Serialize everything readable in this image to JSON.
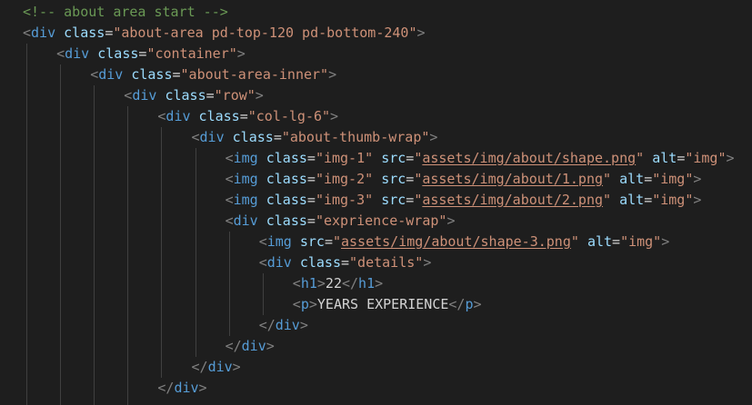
{
  "editor": {
    "language": "html",
    "colors": {
      "background": "#1e1e1e",
      "comment": "#6a9955",
      "tag": "#569cd6",
      "attribute": "#9cdcfe",
      "string": "#ce9178",
      "bracket": "#808080",
      "text": "#d4d4d4",
      "indent_guide": "#404040"
    },
    "lines": [
      {
        "indent": 0,
        "tokens": [
          {
            "t": "comment",
            "v": "<!-- about area start -->"
          }
        ]
      },
      {
        "indent": 0,
        "tokens": [
          {
            "t": "bracket",
            "v": "<"
          },
          {
            "t": "tag",
            "v": "div"
          },
          {
            "t": "text",
            "v": " "
          },
          {
            "t": "attr",
            "v": "class"
          },
          {
            "t": "eq",
            "v": "="
          },
          {
            "t": "str",
            "v": "\"about-area pd-top-120 pd-bottom-240\""
          },
          {
            "t": "bracket",
            "v": ">"
          }
        ]
      },
      {
        "indent": 1,
        "tokens": [
          {
            "t": "bracket",
            "v": "<"
          },
          {
            "t": "tag",
            "v": "div"
          },
          {
            "t": "text",
            "v": " "
          },
          {
            "t": "attr",
            "v": "class"
          },
          {
            "t": "eq",
            "v": "="
          },
          {
            "t": "str",
            "v": "\"container\""
          },
          {
            "t": "bracket",
            "v": ">"
          }
        ]
      },
      {
        "indent": 2,
        "tokens": [
          {
            "t": "bracket",
            "v": "<"
          },
          {
            "t": "tag",
            "v": "div"
          },
          {
            "t": "text",
            "v": " "
          },
          {
            "t": "attr",
            "v": "class"
          },
          {
            "t": "eq",
            "v": "="
          },
          {
            "t": "str",
            "v": "\"about-area-inner\""
          },
          {
            "t": "bracket",
            "v": ">"
          }
        ]
      },
      {
        "indent": 3,
        "tokens": [
          {
            "t": "bracket",
            "v": "<"
          },
          {
            "t": "tag",
            "v": "div"
          },
          {
            "t": "text",
            "v": " "
          },
          {
            "t": "attr",
            "v": "class"
          },
          {
            "t": "eq",
            "v": "="
          },
          {
            "t": "str",
            "v": "\"row\""
          },
          {
            "t": "bracket",
            "v": ">"
          }
        ]
      },
      {
        "indent": 4,
        "tokens": [
          {
            "t": "bracket",
            "v": "<"
          },
          {
            "t": "tag",
            "v": "div"
          },
          {
            "t": "text",
            "v": " "
          },
          {
            "t": "attr",
            "v": "class"
          },
          {
            "t": "eq",
            "v": "="
          },
          {
            "t": "str",
            "v": "\"col-lg-6\""
          },
          {
            "t": "bracket",
            "v": ">"
          }
        ]
      },
      {
        "indent": 5,
        "tokens": [
          {
            "t": "bracket",
            "v": "<"
          },
          {
            "t": "tag",
            "v": "div"
          },
          {
            "t": "text",
            "v": " "
          },
          {
            "t": "attr",
            "v": "class"
          },
          {
            "t": "eq",
            "v": "="
          },
          {
            "t": "str",
            "v": "\"about-thumb-wrap\""
          },
          {
            "t": "bracket",
            "v": ">"
          }
        ]
      },
      {
        "indent": 6,
        "tokens": [
          {
            "t": "bracket",
            "v": "<"
          },
          {
            "t": "tag",
            "v": "img"
          },
          {
            "t": "text",
            "v": " "
          },
          {
            "t": "attr",
            "v": "class"
          },
          {
            "t": "eq",
            "v": "="
          },
          {
            "t": "str",
            "v": "\"img-1\""
          },
          {
            "t": "text",
            "v": " "
          },
          {
            "t": "attr",
            "v": "src"
          },
          {
            "t": "eq",
            "v": "="
          },
          {
            "t": "str",
            "v": "\""
          },
          {
            "t": "link",
            "v": "assets/img/about/shape.png"
          },
          {
            "t": "str",
            "v": "\""
          },
          {
            "t": "text",
            "v": " "
          },
          {
            "t": "attr",
            "v": "alt"
          },
          {
            "t": "eq",
            "v": "="
          },
          {
            "t": "str",
            "v": "\"img\""
          },
          {
            "t": "bracket",
            "v": ">"
          }
        ]
      },
      {
        "indent": 6,
        "tokens": [
          {
            "t": "bracket",
            "v": "<"
          },
          {
            "t": "tag",
            "v": "img"
          },
          {
            "t": "text",
            "v": " "
          },
          {
            "t": "attr",
            "v": "class"
          },
          {
            "t": "eq",
            "v": "="
          },
          {
            "t": "str",
            "v": "\"img-2\""
          },
          {
            "t": "text",
            "v": " "
          },
          {
            "t": "attr",
            "v": "src"
          },
          {
            "t": "eq",
            "v": "="
          },
          {
            "t": "str",
            "v": "\""
          },
          {
            "t": "link",
            "v": "assets/img/about/1.png"
          },
          {
            "t": "str",
            "v": "\""
          },
          {
            "t": "text",
            "v": " "
          },
          {
            "t": "attr",
            "v": "alt"
          },
          {
            "t": "eq",
            "v": "="
          },
          {
            "t": "str",
            "v": "\"img\""
          },
          {
            "t": "bracket",
            "v": ">"
          }
        ]
      },
      {
        "indent": 6,
        "tokens": [
          {
            "t": "bracket",
            "v": "<"
          },
          {
            "t": "tag",
            "v": "img"
          },
          {
            "t": "text",
            "v": " "
          },
          {
            "t": "attr",
            "v": "class"
          },
          {
            "t": "eq",
            "v": "="
          },
          {
            "t": "str",
            "v": "\"img-3\""
          },
          {
            "t": "text",
            "v": " "
          },
          {
            "t": "attr",
            "v": "src"
          },
          {
            "t": "eq",
            "v": "="
          },
          {
            "t": "str",
            "v": "\""
          },
          {
            "t": "link",
            "v": "assets/img/about/2.png"
          },
          {
            "t": "str",
            "v": "\""
          },
          {
            "t": "text",
            "v": " "
          },
          {
            "t": "attr",
            "v": "alt"
          },
          {
            "t": "eq",
            "v": "="
          },
          {
            "t": "str",
            "v": "\"img\""
          },
          {
            "t": "bracket",
            "v": ">"
          }
        ]
      },
      {
        "indent": 6,
        "tokens": [
          {
            "t": "bracket",
            "v": "<"
          },
          {
            "t": "tag",
            "v": "div"
          },
          {
            "t": "text",
            "v": " "
          },
          {
            "t": "attr",
            "v": "class"
          },
          {
            "t": "eq",
            "v": "="
          },
          {
            "t": "str",
            "v": "\"exprience-wrap\""
          },
          {
            "t": "bracket",
            "v": ">"
          }
        ]
      },
      {
        "indent": 7,
        "tokens": [
          {
            "t": "bracket",
            "v": "<"
          },
          {
            "t": "tag",
            "v": "img"
          },
          {
            "t": "text",
            "v": " "
          },
          {
            "t": "attr",
            "v": "src"
          },
          {
            "t": "eq",
            "v": "="
          },
          {
            "t": "str",
            "v": "\""
          },
          {
            "t": "link",
            "v": "assets/img/about/shape-3.png"
          },
          {
            "t": "str",
            "v": "\""
          },
          {
            "t": "text",
            "v": " "
          },
          {
            "t": "attr",
            "v": "alt"
          },
          {
            "t": "eq",
            "v": "="
          },
          {
            "t": "str",
            "v": "\"img\""
          },
          {
            "t": "bracket",
            "v": ">"
          }
        ]
      },
      {
        "indent": 7,
        "tokens": [
          {
            "t": "bracket",
            "v": "<"
          },
          {
            "t": "tag",
            "v": "div"
          },
          {
            "t": "text",
            "v": " "
          },
          {
            "t": "attr",
            "v": "class"
          },
          {
            "t": "eq",
            "v": "="
          },
          {
            "t": "str",
            "v": "\"details\""
          },
          {
            "t": "bracket",
            "v": ">"
          }
        ]
      },
      {
        "indent": 8,
        "tokens": [
          {
            "t": "bracket",
            "v": "<"
          },
          {
            "t": "tag",
            "v": "h1"
          },
          {
            "t": "bracket",
            "v": ">"
          },
          {
            "t": "text",
            "v": "22"
          },
          {
            "t": "bracket",
            "v": "</"
          },
          {
            "t": "tag",
            "v": "h1"
          },
          {
            "t": "bracket",
            "v": ">"
          }
        ]
      },
      {
        "indent": 8,
        "tokens": [
          {
            "t": "bracket",
            "v": "<"
          },
          {
            "t": "tag",
            "v": "p"
          },
          {
            "t": "bracket",
            "v": ">"
          },
          {
            "t": "text",
            "v": "YEARS EXPERIENCE"
          },
          {
            "t": "bracket",
            "v": "</"
          },
          {
            "t": "tag",
            "v": "p"
          },
          {
            "t": "bracket",
            "v": ">"
          }
        ]
      },
      {
        "indent": 7,
        "tokens": [
          {
            "t": "bracket",
            "v": "</"
          },
          {
            "t": "tag",
            "v": "div"
          },
          {
            "t": "bracket",
            "v": ">"
          }
        ]
      },
      {
        "indent": 6,
        "tokens": [
          {
            "t": "bracket",
            "v": "</"
          },
          {
            "t": "tag",
            "v": "div"
          },
          {
            "t": "bracket",
            "v": ">"
          }
        ]
      },
      {
        "indent": 5,
        "tokens": [
          {
            "t": "bracket",
            "v": "</"
          },
          {
            "t": "tag",
            "v": "div"
          },
          {
            "t": "bracket",
            "v": ">"
          }
        ]
      },
      {
        "indent": 4,
        "tokens": [
          {
            "t": "bracket",
            "v": "</"
          },
          {
            "t": "tag",
            "v": "div"
          },
          {
            "t": "bracket",
            "v": ">"
          }
        ]
      },
      {
        "indent": 4,
        "tokens": []
      }
    ]
  }
}
